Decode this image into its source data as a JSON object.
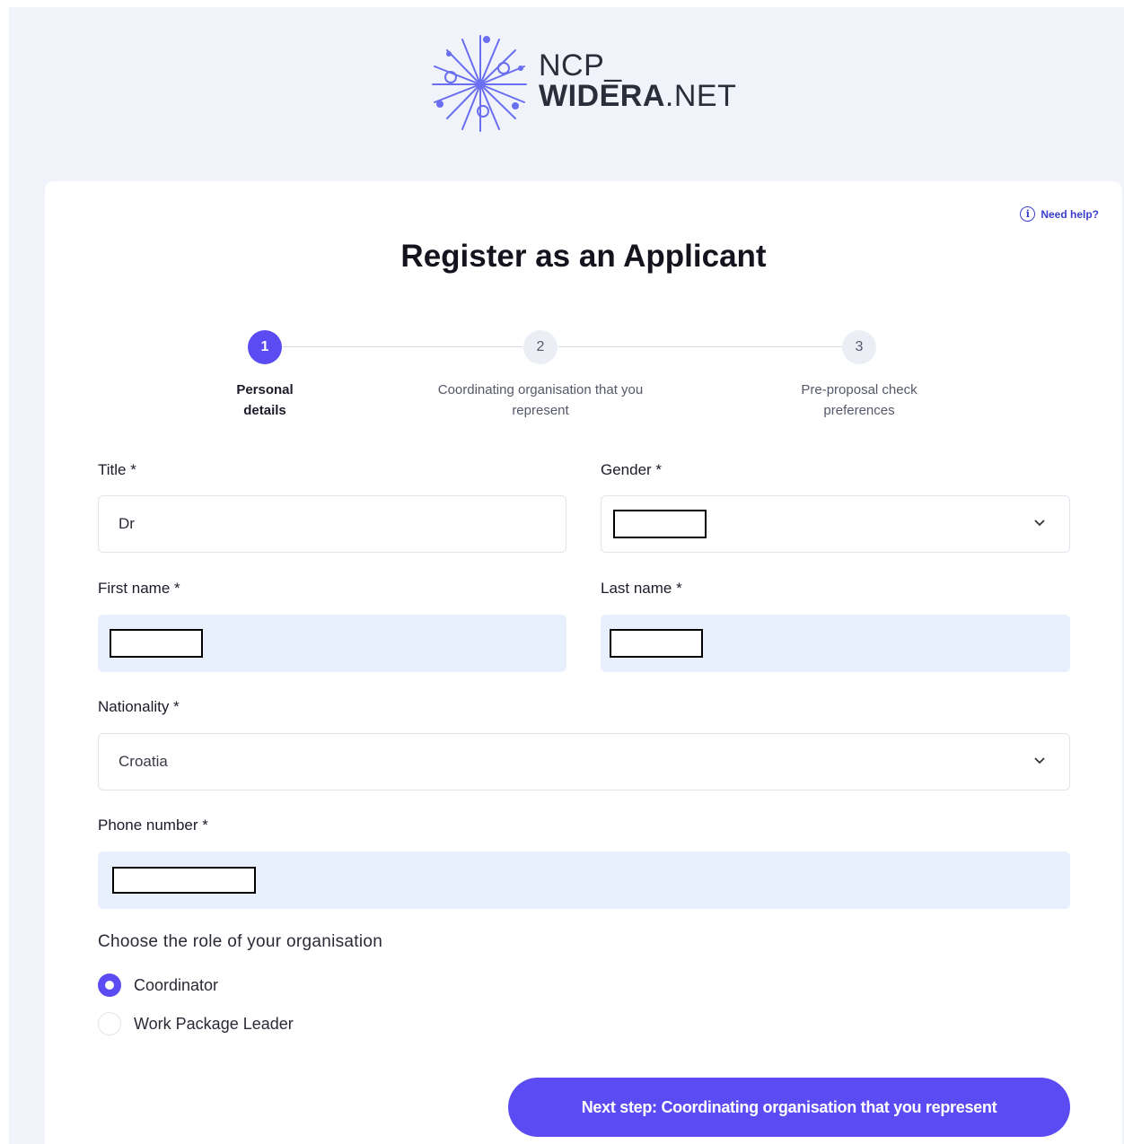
{
  "logo": {
    "line1": "NCP_",
    "line2_bold": "WIDERA",
    "line2_rest": ".NET"
  },
  "help": {
    "label": "Need help?",
    "icon": "info-icon"
  },
  "page_title": "Register as an Applicant",
  "steps": [
    {
      "number": "1",
      "label": "Personal details",
      "state": "active"
    },
    {
      "number": "2",
      "label": "Coordinating organisation that you represent",
      "state": "inactive"
    },
    {
      "number": "3",
      "label": "Pre-proposal check preferences",
      "state": "inactive"
    }
  ],
  "form": {
    "title": {
      "label": "Title *",
      "value": "Dr"
    },
    "gender": {
      "label": "Gender *",
      "value": ""
    },
    "first_name": {
      "label": "First name *",
      "value": ""
    },
    "last_name": {
      "label": "Last name *",
      "value": ""
    },
    "nationality": {
      "label": "Nationality *",
      "value": "Croatia"
    },
    "phone": {
      "label": "Phone number *",
      "value": ""
    }
  },
  "role": {
    "title": "Choose the role of your organisation",
    "options": [
      {
        "label": "Coordinator",
        "selected": true
      },
      {
        "label": "Work Package Leader",
        "selected": false
      }
    ]
  },
  "next_button": "Next step: Coordinating organisation that you represent",
  "colors": {
    "accent": "#5a4cf2",
    "page_bg": "#f1f3fb",
    "autofill_bg": "#e8f0fe"
  }
}
